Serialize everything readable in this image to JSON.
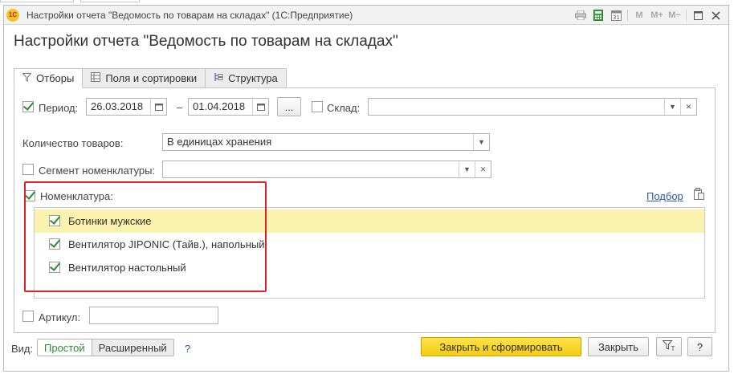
{
  "window": {
    "title": "Настройки отчета \"Ведомость по товарам на складах\"  (1С:Предприятие)",
    "app_icon_text": "1С",
    "toolbar_icons": [
      "print-icon",
      "calculator-icon",
      "calendar-icon",
      "m-icon",
      "m-plus-icon",
      "m-minus-icon",
      "restore-icon",
      "close-icon"
    ],
    "m_label": "M",
    "m_plus_label": "M+",
    "m_minus_label": "M−"
  },
  "form_title": "Настройки отчета \"Ведомость по товарам на складах\"",
  "tabs": [
    {
      "label": "Отборы",
      "icon": "filter-icon",
      "active": true
    },
    {
      "label": "Поля и сортировки",
      "icon": "fields-icon",
      "active": false
    },
    {
      "label": "Структура",
      "icon": "structure-icon",
      "active": false
    }
  ],
  "filters": {
    "period": {
      "label": "Период:",
      "checked": true,
      "from": "26.03.2018",
      "dash": "–",
      "to": "01.04.2018",
      "more_button": "..."
    },
    "warehouse": {
      "label": "Склад:",
      "checked": false,
      "value": ""
    },
    "quantity": {
      "label": "Количество товаров:",
      "value": "В единицах хранения"
    },
    "segment": {
      "label": "Сегмент номенклатуры:",
      "checked": false,
      "value": ""
    },
    "nomenclature": {
      "label": "Номенклатура:",
      "checked": true,
      "pick_link": "Подбор",
      "items": [
        {
          "text": "Ботинки мужские",
          "checked": true,
          "selected": true
        },
        {
          "text": "Вентилятор JIPONIC (Тайв.), напольный",
          "checked": true,
          "selected": false
        },
        {
          "text": "Вентилятор настольный",
          "checked": true,
          "selected": false
        }
      ]
    },
    "article": {
      "label": "Артикул:",
      "checked": false,
      "value": ""
    }
  },
  "footer": {
    "view_label": "Вид:",
    "view_simple": "Простой",
    "view_extended": "Расширенный",
    "help": "?",
    "generate_button": "Закрыть и сформировать",
    "close_button": "Закрыть",
    "help_button": "?"
  },
  "colors": {
    "accent_green": "#2e8b34",
    "highlight_row": "#fbf3ad",
    "primary_button": "#f5cd13",
    "annotation_red": "#d9242a",
    "link_blue": "#2a5aa8"
  }
}
